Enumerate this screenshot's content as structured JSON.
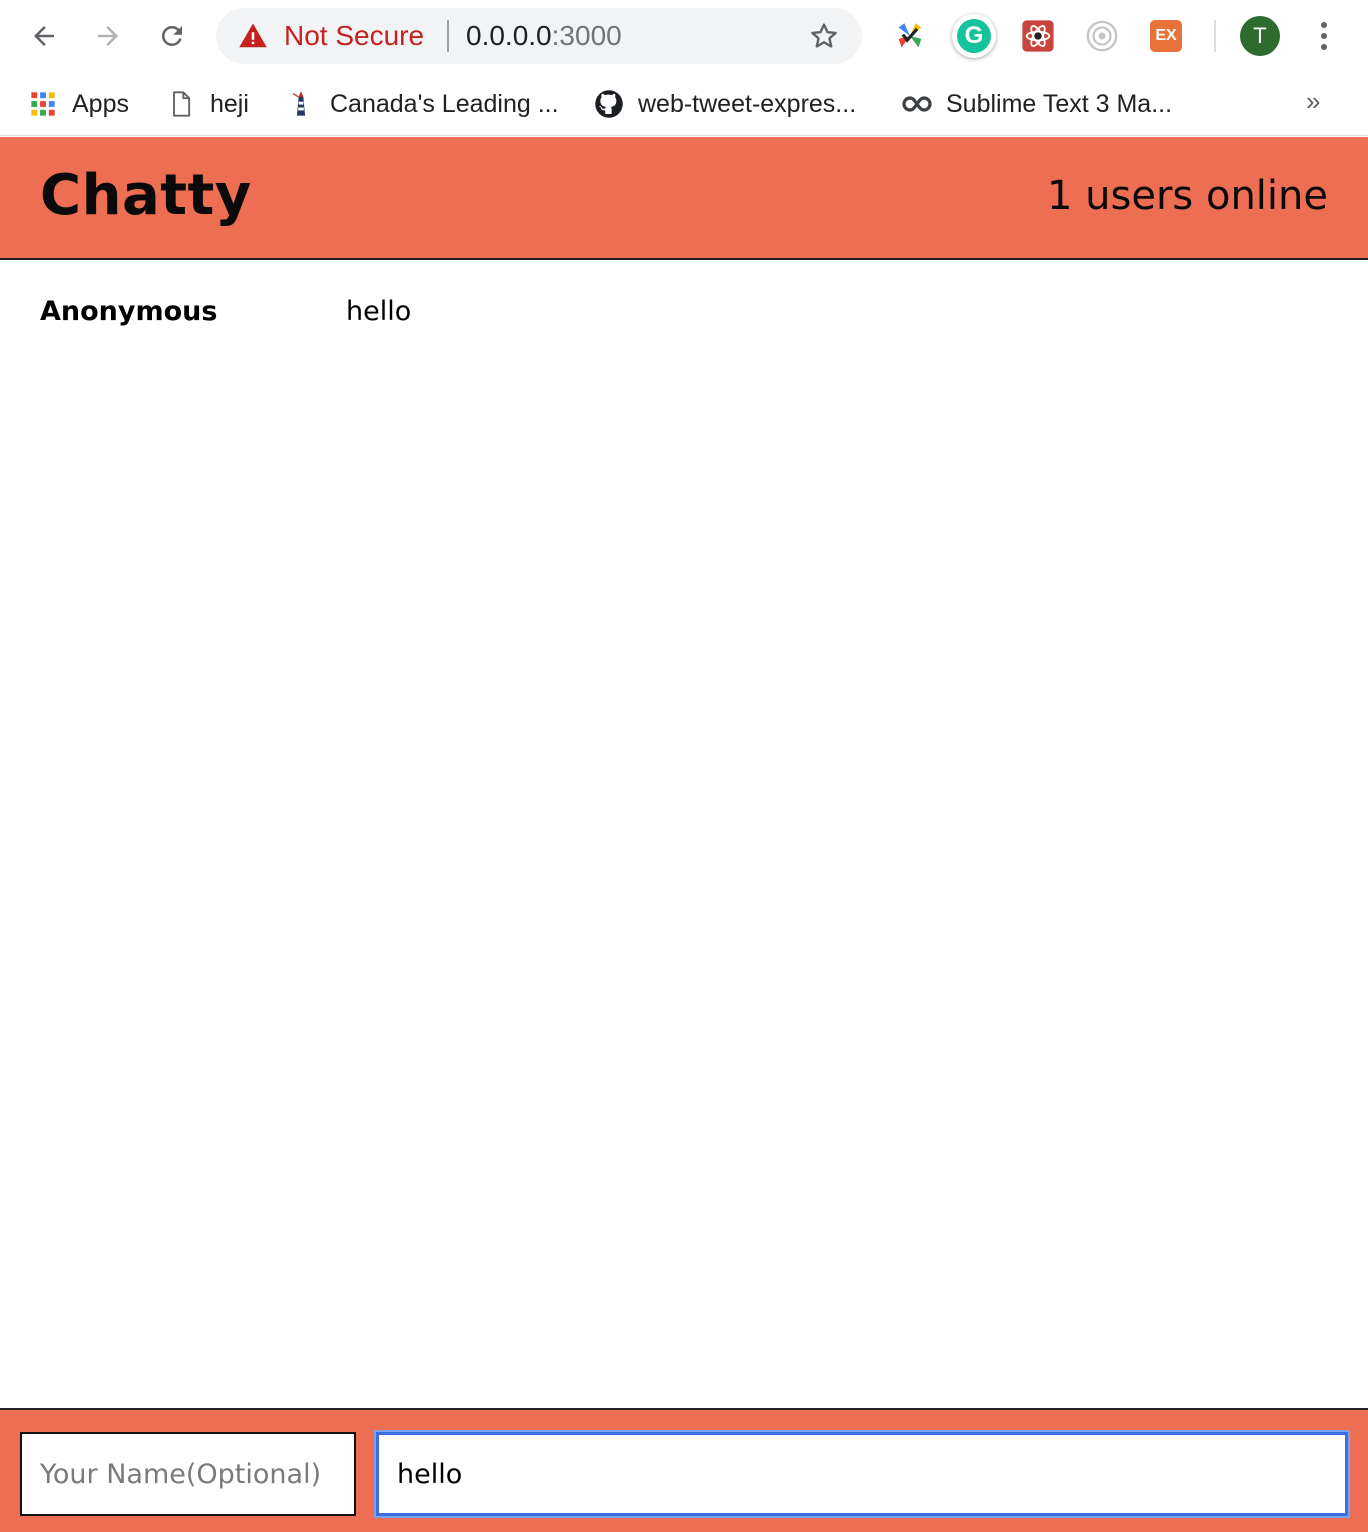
{
  "browser": {
    "security_label": "Not Secure",
    "url_host": "0.0.0.0",
    "url_port": ":3000",
    "avatar_initial": "T",
    "bookmarks": [
      {
        "label": "Apps",
        "icon": "apps-grid-icon"
      },
      {
        "label": "heji",
        "icon": "page-icon"
      },
      {
        "label": "Canada's Leading ...",
        "icon": "lighthouse-icon"
      },
      {
        "label": "web-tweet-expres...",
        "icon": "github-icon"
      },
      {
        "label": "Sublime Text 3 Ma...",
        "icon": "infinity-icon"
      }
    ],
    "more_label": "»",
    "extensions": [
      "pinwheel-extension-icon",
      "grammarly-extension-icon",
      "react-devtools-extension-icon",
      "target-extension-icon",
      "ex-extension-icon"
    ],
    "ex_label": "EX",
    "grammarly_label": "G",
    "colors": {
      "not_secure": "#c5221f",
      "omnibox_bg": "#f1f3f4"
    }
  },
  "app": {
    "title": "Chatty",
    "users_online": "1 users online",
    "messages": [
      {
        "username": "Anonymous",
        "content": "hello"
      }
    ],
    "chatbar": {
      "name_placeholder": "Your Name(Optional)",
      "name_value": "",
      "message_value": "hello"
    },
    "colors": {
      "accent": "#ed6e52",
      "focus_ring": "#3b6fe0"
    }
  }
}
